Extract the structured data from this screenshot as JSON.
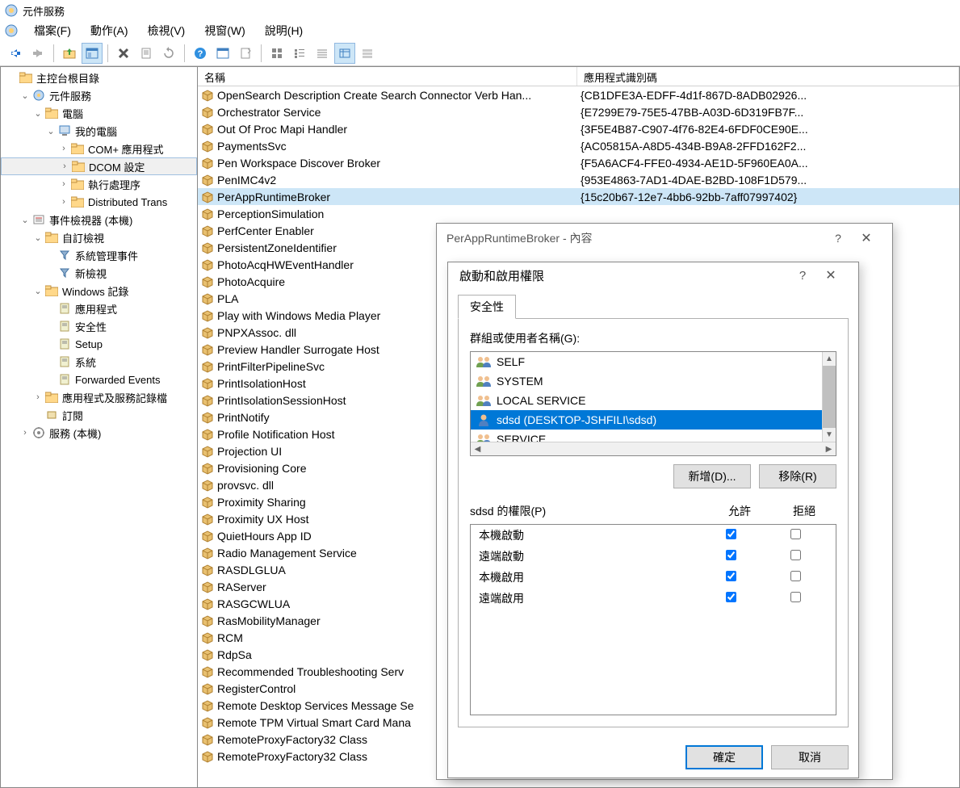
{
  "window": {
    "title": "元件服務"
  },
  "menu": {
    "items": [
      "檔案(F)",
      "動作(A)",
      "檢視(V)",
      "視窗(W)",
      "說明(H)"
    ]
  },
  "tree": {
    "root": "主控台根目錄",
    "component_services": "元件服務",
    "computers": "電腦",
    "my_computer": "我的電腦",
    "com_apps": "COM+ 應用程式",
    "dcom_config": "DCOM 設定",
    "running_processes": "執行處理序",
    "distributed_trans": "Distributed Trans",
    "event_viewer": "事件檢視器 (本機)",
    "custom_views": "自訂檢視",
    "admin_events": "系統管理事件",
    "new_view": "新檢視",
    "windows_logs": "Windows 記錄",
    "application": "應用程式",
    "security": "安全性",
    "setup": "Setup",
    "system": "系統",
    "forwarded": "Forwarded Events",
    "app_service_logs": "應用程式及服務記錄檔",
    "subscriptions": "訂閱",
    "services": "服務 (本機)"
  },
  "list": {
    "header_name": "名稱",
    "header_id": "應用程式識別碼",
    "rows": [
      {
        "name": "OpenSearch Description Create Search Connector Verb Han...",
        "id": "{CB1DFE3A-EDFF-4d1f-867D-8ADB02926..."
      },
      {
        "name": "Orchestrator Service",
        "id": "{E7299E79-75E5-47BB-A03D-6D319FB7F..."
      },
      {
        "name": "Out Of Proc Mapi Handler",
        "id": "{3F5E4B87-C907-4f76-82E4-6FDF0CE90E..."
      },
      {
        "name": "PaymentsSvc",
        "id": "{AC05815A-A8D5-434B-B9A8-2FFD162F2..."
      },
      {
        "name": "Pen Workspace Discover Broker",
        "id": "{F5A6ACF4-FFE0-4934-AE1D-5F960EA0A..."
      },
      {
        "name": "PenIMC4v2",
        "id": "{953E4863-7AD1-4DAE-B2BD-108F1D579..."
      },
      {
        "name": "PerAppRuntimeBroker",
        "id": "{15c20b67-12e7-4bb6-92bb-7aff07997402}"
      },
      {
        "name": "PerceptionSimulation",
        "id": ""
      },
      {
        "name": "PerfCenter Enabler",
        "id": ""
      },
      {
        "name": "PersistentZoneIdentifier",
        "id": ""
      },
      {
        "name": "PhotoAcqHWEventHandler",
        "id": ""
      },
      {
        "name": "PhotoAcquire",
        "id": ""
      },
      {
        "name": "PLA",
        "id": ""
      },
      {
        "name": "Play with Windows Media Player",
        "id": ""
      },
      {
        "name": "PNPXAssoc. dll",
        "id": ""
      },
      {
        "name": "Preview Handler Surrogate Host",
        "id": ""
      },
      {
        "name": "PrintFilterPipelineSvc",
        "id": ""
      },
      {
        "name": "PrintIsolationHost",
        "id": ""
      },
      {
        "name": "PrintIsolationSessionHost",
        "id": ""
      },
      {
        "name": "PrintNotify",
        "id": ""
      },
      {
        "name": "Profile Notification Host",
        "id": ""
      },
      {
        "name": "Projection UI",
        "id": ""
      },
      {
        "name": "Provisioning Core",
        "id": ""
      },
      {
        "name": "provsvc. dll",
        "id": ""
      },
      {
        "name": "Proximity Sharing",
        "id": ""
      },
      {
        "name": "Proximity UX Host",
        "id": ""
      },
      {
        "name": "QuietHours App ID",
        "id": ""
      },
      {
        "name": "Radio Management Service",
        "id": ""
      },
      {
        "name": "RASDLGLUA",
        "id": ""
      },
      {
        "name": "RAServer",
        "id": ""
      },
      {
        "name": "RASGCWLUA",
        "id": ""
      },
      {
        "name": "RasMobilityManager",
        "id": ""
      },
      {
        "name": "RCM",
        "id": ""
      },
      {
        "name": "RdpSa",
        "id": ""
      },
      {
        "name": "Recommended Troubleshooting Serv",
        "id": ""
      },
      {
        "name": "RegisterControl",
        "id": ""
      },
      {
        "name": "Remote Desktop Services Message Se",
        "id": ""
      },
      {
        "name": "Remote TPM Virtual Smart Card Mana",
        "id": ""
      },
      {
        "name": "RemoteProxyFactory32 Class",
        "id": ""
      },
      {
        "name": "RemoteProxyFactory32 Class",
        "id": ""
      }
    ]
  },
  "dialog1": {
    "title": "PerAppRuntimeBroker - 內容"
  },
  "dialog2": {
    "title": "啟動和啟用權限",
    "tab": "安全性",
    "users_label": "群組或使用者名稱(G):",
    "users": [
      "SELF",
      "SYSTEM",
      "LOCAL SERVICE",
      "sdsd (DESKTOP-JSHFILI\\sdsd)",
      "SERVICE"
    ],
    "selected_user_index": 3,
    "add_btn": "新增(D)...",
    "remove_btn": "移除(R)",
    "perm_label": "sdsd 的權限(P)",
    "allow_header": "允許",
    "deny_header": "拒絕",
    "permissions": [
      {
        "label": "本機啟動",
        "allow": true,
        "deny": false
      },
      {
        "label": "遠端啟動",
        "allow": true,
        "deny": false
      },
      {
        "label": "本機啟用",
        "allow": true,
        "deny": false
      },
      {
        "label": "遠端啟用",
        "allow": true,
        "deny": false
      }
    ],
    "ok_btn": "確定",
    "cancel_btn": "取消"
  }
}
